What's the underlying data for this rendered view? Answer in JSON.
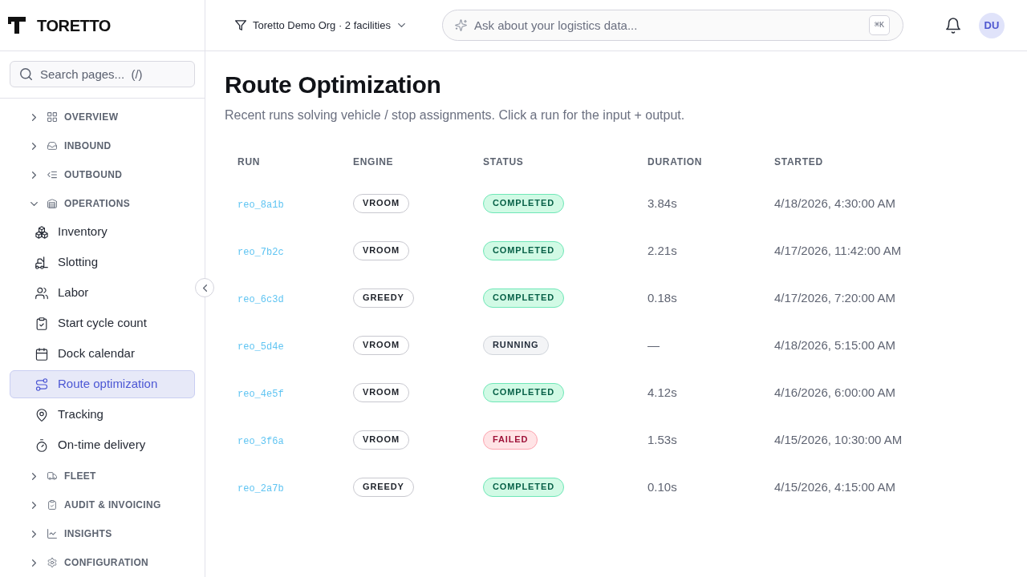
{
  "brand": {
    "name": "TORETTO"
  },
  "sidebar": {
    "search": {
      "placeholder": "Search pages...  (/)"
    },
    "sections": [
      {
        "label": "OVERVIEW",
        "expanded": false
      },
      {
        "label": "INBOUND",
        "expanded": false
      },
      {
        "label": "OUTBOUND",
        "expanded": false
      },
      {
        "label": "OPERATIONS",
        "expanded": true,
        "children": [
          {
            "label": "Inventory",
            "selected": false
          },
          {
            "label": "Slotting",
            "selected": false
          },
          {
            "label": "Labor",
            "selected": false
          },
          {
            "label": "Start cycle count",
            "selected": false
          },
          {
            "label": "Dock calendar",
            "selected": false
          },
          {
            "label": "Route optimization",
            "selected": true
          },
          {
            "label": "Tracking",
            "selected": false
          },
          {
            "label": "On-time delivery",
            "selected": false
          }
        ]
      },
      {
        "label": "FLEET",
        "expanded": false
      },
      {
        "label": "AUDIT & INVOICING",
        "expanded": false
      },
      {
        "label": "INSIGHTS",
        "expanded": false
      },
      {
        "label": "CONFIGURATION",
        "expanded": false
      }
    ]
  },
  "topbar": {
    "org_filter": "Toretto Demo Org · 2 facilities",
    "ask": {
      "placeholder": "Ask about your logistics data...",
      "shortcut": "⌘K"
    },
    "avatar": "DU"
  },
  "page": {
    "title": "Route Optimization",
    "subtitle": "Recent runs solving vehicle / stop assignments. Click a run for the input + output.",
    "table": {
      "columns": [
        "RUN",
        "ENGINE",
        "STATUS",
        "DURATION",
        "STARTED"
      ],
      "rows": [
        {
          "run": "reo_8a1b",
          "engine": "VROOM",
          "status": {
            "label": "COMPLETED",
            "kind": "success"
          },
          "duration": "3.84s",
          "started": "4/18/2026, 4:30:00 AM"
        },
        {
          "run": "reo_7b2c",
          "engine": "VROOM",
          "status": {
            "label": "COMPLETED",
            "kind": "success"
          },
          "duration": "2.21s",
          "started": "4/17/2026, 11:42:00 AM"
        },
        {
          "run": "reo_6c3d",
          "engine": "GREEDY",
          "status": {
            "label": "COMPLETED",
            "kind": "success"
          },
          "duration": "0.18s",
          "started": "4/17/2026, 7:20:00 AM"
        },
        {
          "run": "reo_5d4e",
          "engine": "VROOM",
          "status": {
            "label": "RUNNING",
            "kind": "neutral"
          },
          "duration": "—",
          "started": "4/18/2026, 5:15:00 AM"
        },
        {
          "run": "reo_4e5f",
          "engine": "VROOM",
          "status": {
            "label": "COMPLETED",
            "kind": "success"
          },
          "duration": "4.12s",
          "started": "4/16/2026, 6:00:00 AM"
        },
        {
          "run": "reo_3f6a",
          "engine": "VROOM",
          "status": {
            "label": "FAILED",
            "kind": "danger"
          },
          "duration": "1.53s",
          "started": "4/15/2026, 10:30:00 AM"
        },
        {
          "run": "reo_2a7b",
          "engine": "GREEDY",
          "status": {
            "label": "COMPLETED",
            "kind": "success"
          },
          "duration": "0.10s",
          "started": "4/15/2026, 4:15:00 AM"
        }
      ]
    }
  }
}
